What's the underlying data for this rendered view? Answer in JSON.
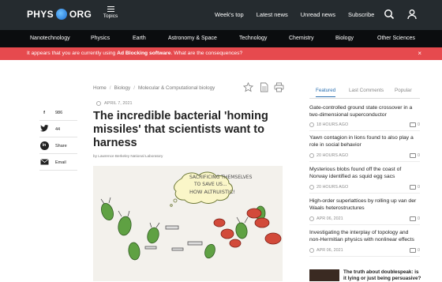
{
  "header": {
    "logo_left": "PHYS",
    "logo_right": "ORG",
    "topics_label": "Topics",
    "nav": [
      "Week's top",
      "Latest news",
      "Unread news",
      "Subscribe"
    ]
  },
  "categories": [
    "Nanotechnology",
    "Physics",
    "Earth",
    "Astronomy & Space",
    "Technology",
    "Chemistry",
    "Biology",
    "Other Sciences"
  ],
  "adblock": {
    "prefix": "It appears that you are currently using",
    "bold": "Ad Blocking software",
    "suffix": ". What are the consequences?",
    "close": "×"
  },
  "share": [
    {
      "icon": "f",
      "label": "986"
    },
    {
      "icon": "t",
      "label": "44"
    },
    {
      "icon": "in",
      "label": "Share"
    },
    {
      "icon": "✉",
      "label": "Email"
    }
  ],
  "breadcrumb": [
    "Home",
    "Biology",
    "Molecular & Computational biology"
  ],
  "article": {
    "date": "APRIL 7, 2021",
    "title": "The incredible bacterial 'homing missiles' that scientists want to harness",
    "byline": "by Lawrence Berkeley National Laboratory",
    "figure_caption": "SACRIFICING THEMSELVES TO SAVE US... HOW ALTRUISTIC!"
  },
  "sidebar": {
    "tabs": [
      "Featured",
      "Last Comments",
      "Popular"
    ],
    "items": [
      {
        "headline": "Gate-controlled ground state crossover in a two-dimensional superconductor",
        "time": "18 HOURS AGO",
        "comments": "0"
      },
      {
        "headline": "Yawn contagion in lions found to also play a role in social behavior",
        "time": "20 HOURS AGO",
        "comments": "0"
      },
      {
        "headline": "Mysterious blobs found off the coast of Norway identified as squid egg sacs",
        "time": "20 HOURS AGO",
        "comments": "0"
      },
      {
        "headline": "High-order superlattices by rolling up van der Waals heterostructures",
        "time": "APR 06, 2021",
        "comments": "0"
      },
      {
        "headline": "Investigating the interplay of topology and non-Hermitian physics with nonlinear effects",
        "time": "APR 06, 2021",
        "comments": "0"
      }
    ],
    "promo": "The truth about doublespeak: is it lying or just being persuasive?"
  },
  "colors": {
    "topbar": "#252b2f",
    "catbar": "#0b0d0f",
    "adbar": "#e64a4e",
    "accent": "#2a6fb0"
  }
}
